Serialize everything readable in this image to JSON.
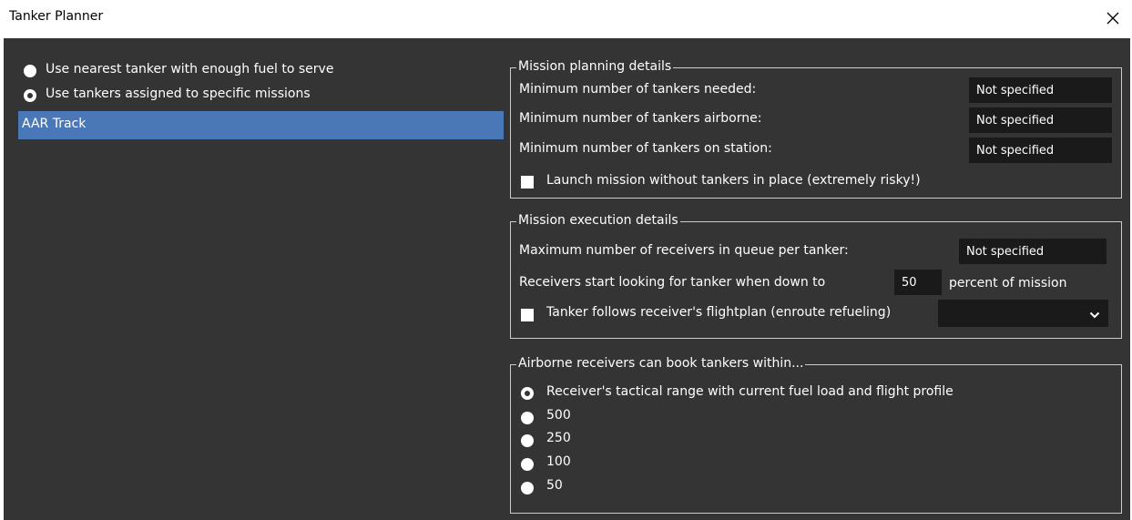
{
  "window": {
    "title": "Tanker Planner",
    "close_icon": "close-icon"
  },
  "left": {
    "radio_nearest_label": "Use nearest tanker with enough fuel to serve",
    "radio_assigned_label": "Use tankers assigned to specific missions",
    "selected_radio": "assigned",
    "mission_list": [
      {
        "label": "AAR Track",
        "selected": true
      }
    ]
  },
  "planning": {
    "legend": "Mission planning details",
    "min_needed_label": "Minimum number of tankers needed:",
    "min_needed_value": "Not specified",
    "min_airborne_label": "Minimum number of tankers airborne:",
    "min_airborne_value": "Not specified",
    "min_on_station_label": "Minimum number of tankers on station:",
    "min_on_station_value": "Not specified",
    "launch_without_label": "Launch mission without tankers in place (extremely risky!)",
    "launch_without_checked": false
  },
  "execution": {
    "legend": "Mission execution details",
    "max_queue_label": "Maximum number of receivers in queue per tanker:",
    "max_queue_value": "Not specified",
    "start_looking_prefix": "Receivers start looking for tanker when down to",
    "start_looking_value": "50",
    "start_looking_suffix": "percent of mission",
    "follows_flightplan_label": "Tanker follows receiver's flightplan (enroute refueling)",
    "follows_flightplan_checked": false,
    "dropdown_value": "",
    "dropdown_icon": "chevron-down-icon"
  },
  "booking": {
    "legend": "Airborne receivers can book tankers within...",
    "selected_index": 0,
    "options": [
      "Receiver's tactical range with current fuel load and flight profile",
      "500",
      "250",
      "100",
      "50"
    ]
  },
  "colors": {
    "panel_bg": "#343434",
    "field_bg": "#1a1a1a",
    "selection": "#4a77b5",
    "group_border": "#cccccc"
  }
}
